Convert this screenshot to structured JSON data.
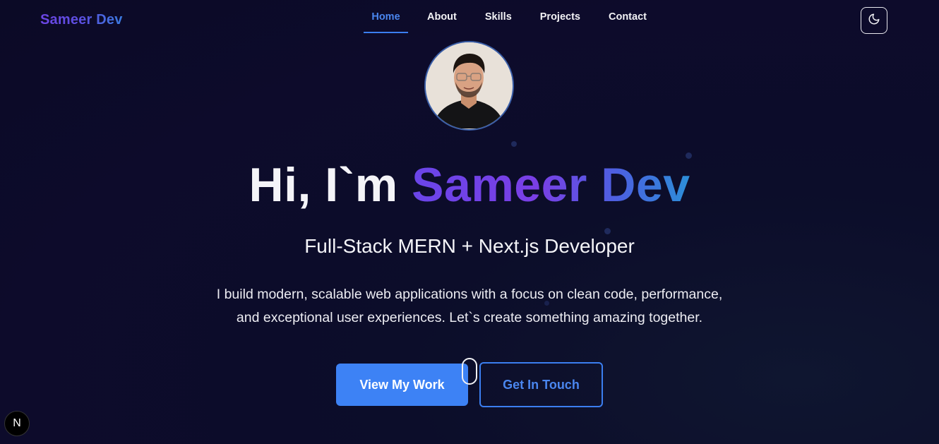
{
  "header": {
    "brand": "Sameer Dev",
    "nav": [
      {
        "label": "Home",
        "active": true
      },
      {
        "label": "About"
      },
      {
        "label": "Skills"
      },
      {
        "label": "Projects"
      },
      {
        "label": "Contact"
      }
    ],
    "theme_toggle_icon": "moon-icon"
  },
  "hero": {
    "avatar_icon": "profile-photo",
    "title_greeting": "Hi, I`m ",
    "title_name": "Sameer Dev",
    "subtitle": "Full-Stack MERN + Next.js Developer",
    "description_line1": "I build modern, scalable web applications with a focus on clean code, performance,",
    "description_line2": "and exceptional user experiences. Let`s create something amazing together.",
    "primary_button": "View My Work",
    "secondary_button": "Get In Touch"
  },
  "dev_badge": {
    "label": "N"
  },
  "colors": {
    "accent": "#3d82f5",
    "background": "#0d0b2b",
    "gradient_start": "#6a45e8",
    "gradient_end": "#2c8fd8"
  }
}
